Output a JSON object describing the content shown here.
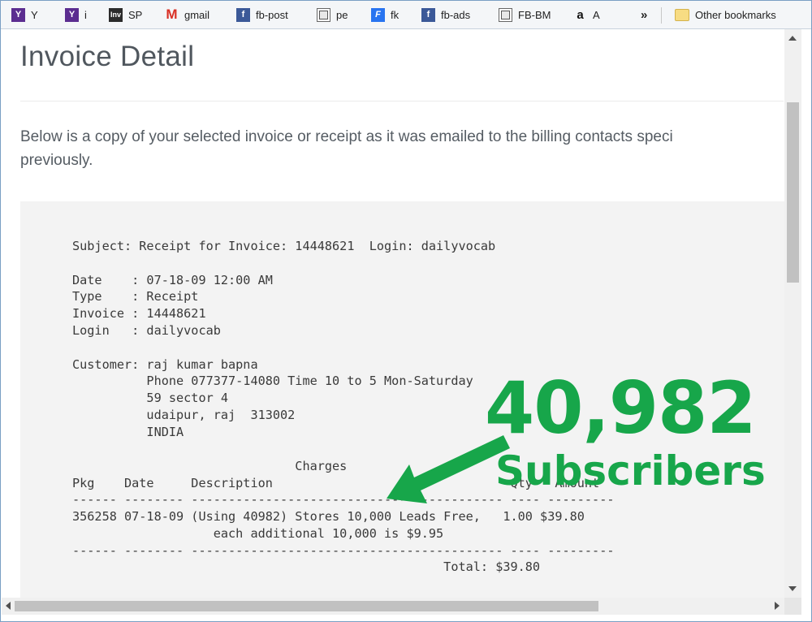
{
  "bookmarks": [
    {
      "label": "Y",
      "icon": "yahoo-icon"
    },
    {
      "label": "i",
      "icon": "yahoo-icon"
    },
    {
      "label": "SP",
      "icon": "inv-icon"
    },
    {
      "label": "gmail",
      "icon": "gmail-icon"
    },
    {
      "label": "fb-post",
      "icon": "facebook-icon"
    },
    {
      "label": "pe",
      "icon": "page-icon"
    },
    {
      "label": "fk",
      "icon": "flipkart-icon"
    },
    {
      "label": "fb-ads",
      "icon": "facebook-icon"
    },
    {
      "label": "FB-BM",
      "icon": "page-icon"
    },
    {
      "label": "A",
      "icon": "amazon-icon"
    }
  ],
  "bookmarks_overflow": "»",
  "other_bookmarks": "Other bookmarks",
  "icon_glyphs": {
    "yahoo": "Y",
    "inv": "Inv",
    "gmail": "M",
    "facebook": "f",
    "flipkart": "F",
    "amazon": "a"
  },
  "page": {
    "title": "Invoice Detail",
    "intro_line1": "Below is a copy of your selected invoice or receipt as it was emailed to the billing contacts speci",
    "intro_line2": "previously."
  },
  "receipt": {
    "subject": "Subject: Receipt for Invoice: 14448621  Login: dailyvocab",
    "date": "Date    : 07-18-09 12:00 AM",
    "type": "Type    : Receipt",
    "invoice": "Invoice : 14448621",
    "login": "Login   : dailyvocab",
    "customer": "Customer: raj kumar bapna",
    "phone": "          Phone 077377-14080 Time 10 to 5 Mon-Saturday",
    "address1": "          59 sector 4",
    "address2": "          udaipur, raj  313002",
    "country": "          INDIA",
    "charges_heading": "                              Charges",
    "col_headers": "Pkg    Date     Description                                Qty   Amount",
    "divider": "------ -------- ------------------------------------------ ---- ---------",
    "row1": "356258 07-18-09 (Using 40982) Stores 10,000 Leads Free,   1.00 $39.80",
    "row1_cont": "                   each additional 10,000 is $9.95",
    "divider2": "------ -------- ------------------------------------------ ---- ---------",
    "total": "                                                  Total: $39.80"
  },
  "annotation": {
    "count": "40,982",
    "label": "Subscribers",
    "color": "#17a64a"
  }
}
